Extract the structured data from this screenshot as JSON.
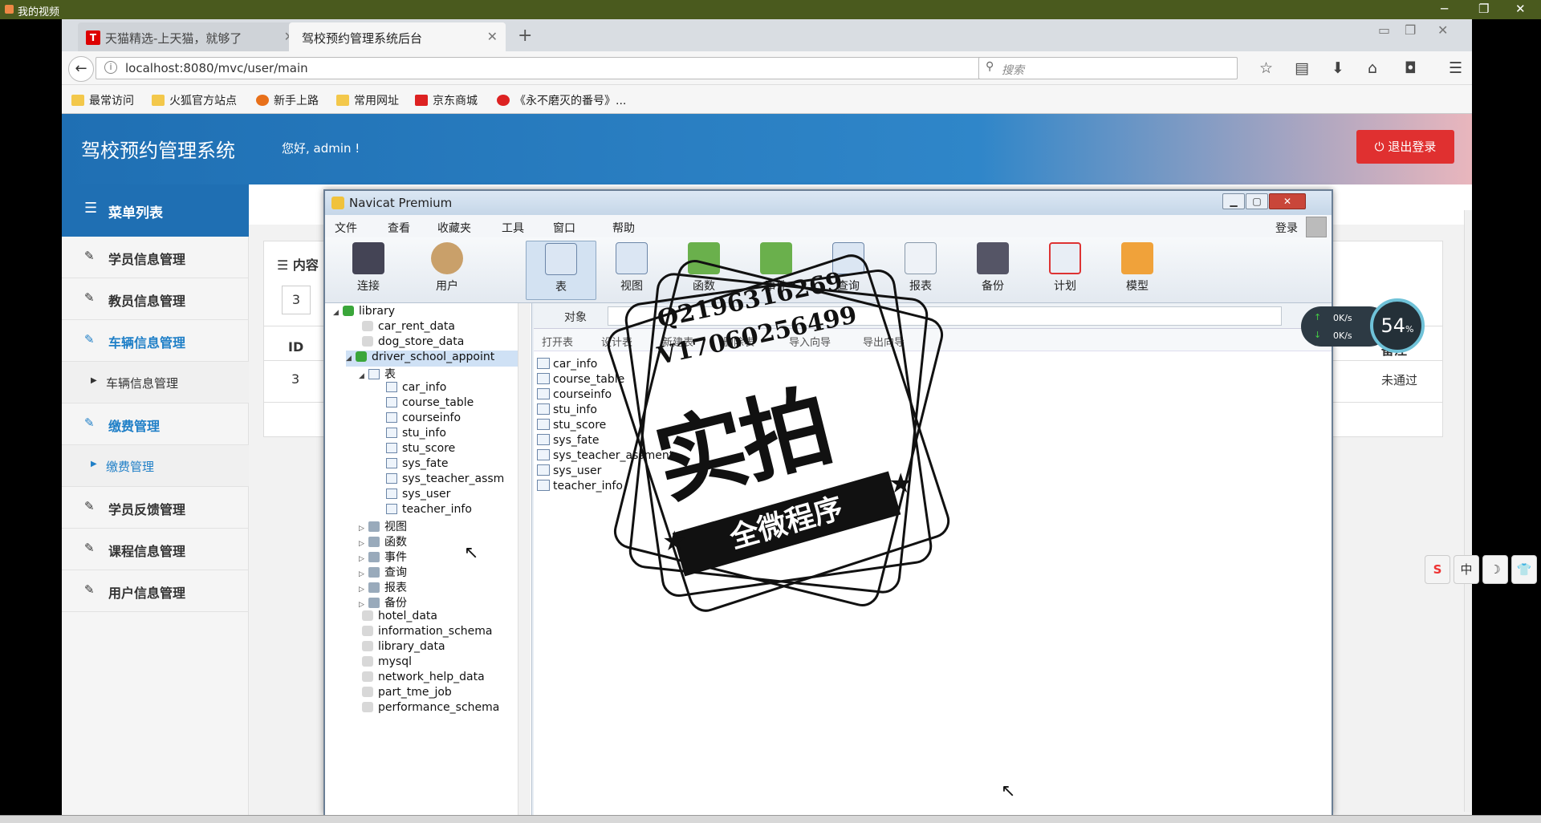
{
  "player": {
    "title": "我的视频",
    "controls": {
      "minimize": "─",
      "restore": "❐",
      "close": "✕"
    }
  },
  "browser": {
    "tabs": [
      {
        "label": "天猫精选-上天猫，就够了",
        "favicon": "T",
        "active": false
      },
      {
        "label": "驾校预约管理系统后台",
        "active": true
      }
    ],
    "new_tab": "+",
    "url": "localhost:8080/mvc/user/main",
    "search_placeholder": "搜索",
    "bookmarks": [
      "最常访问",
      "火狐官方站点",
      "新手上路",
      "常用网址",
      "京东商城",
      "《永不磨灭的番号》..."
    ]
  },
  "app": {
    "title": "驾校预约管理系统",
    "welcome": "您好, admin !",
    "logout": "退出登录",
    "menu_header": "菜单列表",
    "menu": [
      {
        "label": "学员信息管理",
        "active": false
      },
      {
        "label": "教员信息管理",
        "active": false
      },
      {
        "label": "车辆信息管理",
        "active": true
      },
      {
        "label": "车辆信息管理",
        "sub": true,
        "active": false
      },
      {
        "label": "缴费管理",
        "active": true
      },
      {
        "label": "缴费管理",
        "sub": true,
        "active": true
      },
      {
        "label": "学员反馈管理",
        "active": false
      },
      {
        "label": "课程信息管理",
        "active": false
      },
      {
        "label": "用户信息管理",
        "active": false
      }
    ],
    "panel": {
      "title": "内容",
      "rows_per_page": "3",
      "col_id": "ID",
      "col_note": "备注",
      "row_id": "3",
      "row_note": "未通过"
    }
  },
  "navicat": {
    "title": "Navicat Premium",
    "menu": [
      "文件",
      "查看",
      "收藏夹",
      "工具",
      "窗口",
      "帮助"
    ],
    "login": "登录",
    "toolbar": [
      "连接",
      "用户",
      "表",
      "视图",
      "函数",
      "事件",
      "查询",
      "报表",
      "备份",
      "计划",
      "模型"
    ],
    "tree": {
      "library": "library",
      "databases_top": [
        "car_rent_data",
        "dog_store_data"
      ],
      "active_db": "driver_school_appoint",
      "tables_node": "表",
      "tables": [
        "car_info",
        "course_table",
        "courseinfo",
        "stu_info",
        "stu_score",
        "sys_fate",
        "sys_teacher_assm",
        "sys_user",
        "teacher_info"
      ],
      "nodes": [
        "视图",
        "函数",
        "事件",
        "查询",
        "报表",
        "备份"
      ],
      "databases_bottom": [
        "hotel_data",
        "information_schema",
        "library_data",
        "mysql",
        "network_help_data",
        "part_tme_job",
        "performance_schema"
      ]
    },
    "object_label": "对象",
    "object_bar": [
      "打开表",
      "设计表",
      "新建表",
      "删除表",
      "导入向导",
      "导出向导"
    ],
    "objects": [
      "car_info",
      "course_table",
      "courseinfo",
      "stu_info",
      "stu_score",
      "sys_fate",
      "sys_teacher_assment",
      "sys_user",
      "teacher_info"
    ]
  },
  "overlay": {
    "net_up": "0K/s",
    "net_down": "0K/s",
    "cpu": "54",
    "cpu_unit": "%",
    "ime": [
      "S",
      "中",
      "☽",
      "👕"
    ],
    "watermark_qq": "Q2196316269",
    "watermark_wx": "V17060256499",
    "watermark_big": "实拍",
    "watermark_ribbon": "全微程序"
  }
}
